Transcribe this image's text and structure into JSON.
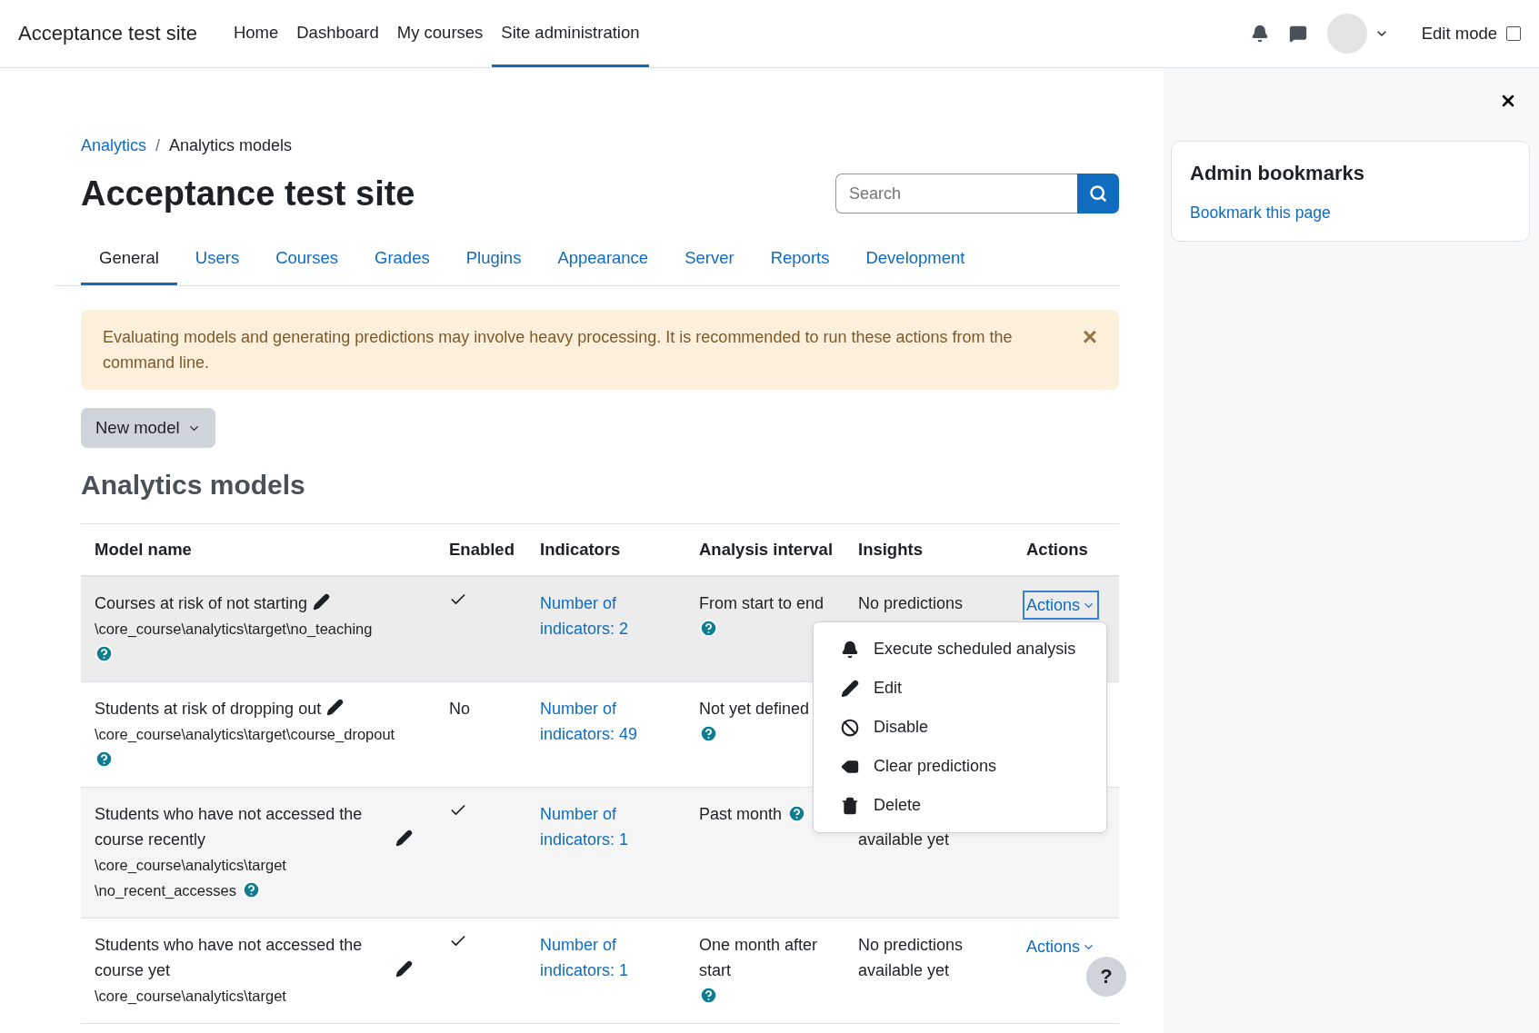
{
  "navbar": {
    "site_name": "Acceptance test site",
    "links": [
      {
        "label": "Home",
        "selected": false
      },
      {
        "label": "Dashboard",
        "selected": false
      },
      {
        "label": "My courses",
        "selected": false
      },
      {
        "label": "Site administration",
        "selected": true
      }
    ],
    "edit_mode": {
      "label": "Edit mode",
      "checked": false
    }
  },
  "breadcrumb_separator": "/",
  "breadcrumb": [
    {
      "label": "Analytics",
      "link": true
    },
    {
      "label": "Analytics models",
      "link": false
    }
  ],
  "page_title": "Acceptance test site",
  "search": {
    "placeholder": "Search"
  },
  "tabs": [
    {
      "label": "General",
      "selected": true
    },
    {
      "label": "Users",
      "selected": false
    },
    {
      "label": "Courses",
      "selected": false
    },
    {
      "label": "Grades",
      "selected": false
    },
    {
      "label": "Plugins",
      "selected": false
    },
    {
      "label": "Appearance",
      "selected": false
    },
    {
      "label": "Server",
      "selected": false
    },
    {
      "label": "Reports",
      "selected": false
    },
    {
      "label": "Development",
      "selected": false
    }
  ],
  "alert": {
    "text": "Evaluating models and generating predictions may involve heavy processing. It is recommended to run these actions from the command line.",
    "close": "×"
  },
  "new_model_button": "New model",
  "section_title": "Analytics models",
  "table": {
    "columns": [
      "Model name",
      "Enabled",
      "Indicators",
      "Analysis interval",
      "Insights",
      "Actions"
    ],
    "rows": [
      {
        "name": "Courses at risk of not starting",
        "target": [
          "\\core_course\\analytics\\target\\no_teaching"
        ],
        "help": true,
        "enabled": true,
        "indicators": "Number of indicators: 2",
        "interval": "From start to end",
        "insights": "No predictions",
        "actions": "Actions",
        "actions_open": true,
        "highlighted": true
      },
      {
        "name": "Students at risk of dropping out",
        "target": [
          "\\core_course\\analytics\\target\\course_dropout"
        ],
        "help": true,
        "enabled": false,
        "enabled_label": "No",
        "indicators": "Number of indicators: 49",
        "interval": "Not yet defined",
        "highlighted": false
      },
      {
        "name": "Students who have not accessed the course recently",
        "target": [
          "\\core_course\\analytics\\target",
          "\\no_recent_accesses"
        ],
        "help": true,
        "enabled": true,
        "indicators": "Number of indicators: 1",
        "interval": "Past month",
        "insights": "available yet",
        "insights_continued": true,
        "highlighted": false
      },
      {
        "name": "Students who have not accessed the course yet",
        "target": [
          "\\core_course\\analytics\\target"
        ],
        "help": false,
        "enabled": true,
        "indicators": "Number of indicators: 1",
        "interval": "One month after start",
        "insights": "No predictions available yet",
        "actions": "Actions",
        "actions_open": false,
        "highlighted": false
      }
    ]
  },
  "actions_menu": [
    "Execute scheduled analysis",
    "Edit",
    "Disable",
    "Clear predictions",
    "Delete"
  ],
  "drawer": {
    "title": "Admin bookmarks",
    "link": "Bookmark this page"
  },
  "help_button": "?"
}
